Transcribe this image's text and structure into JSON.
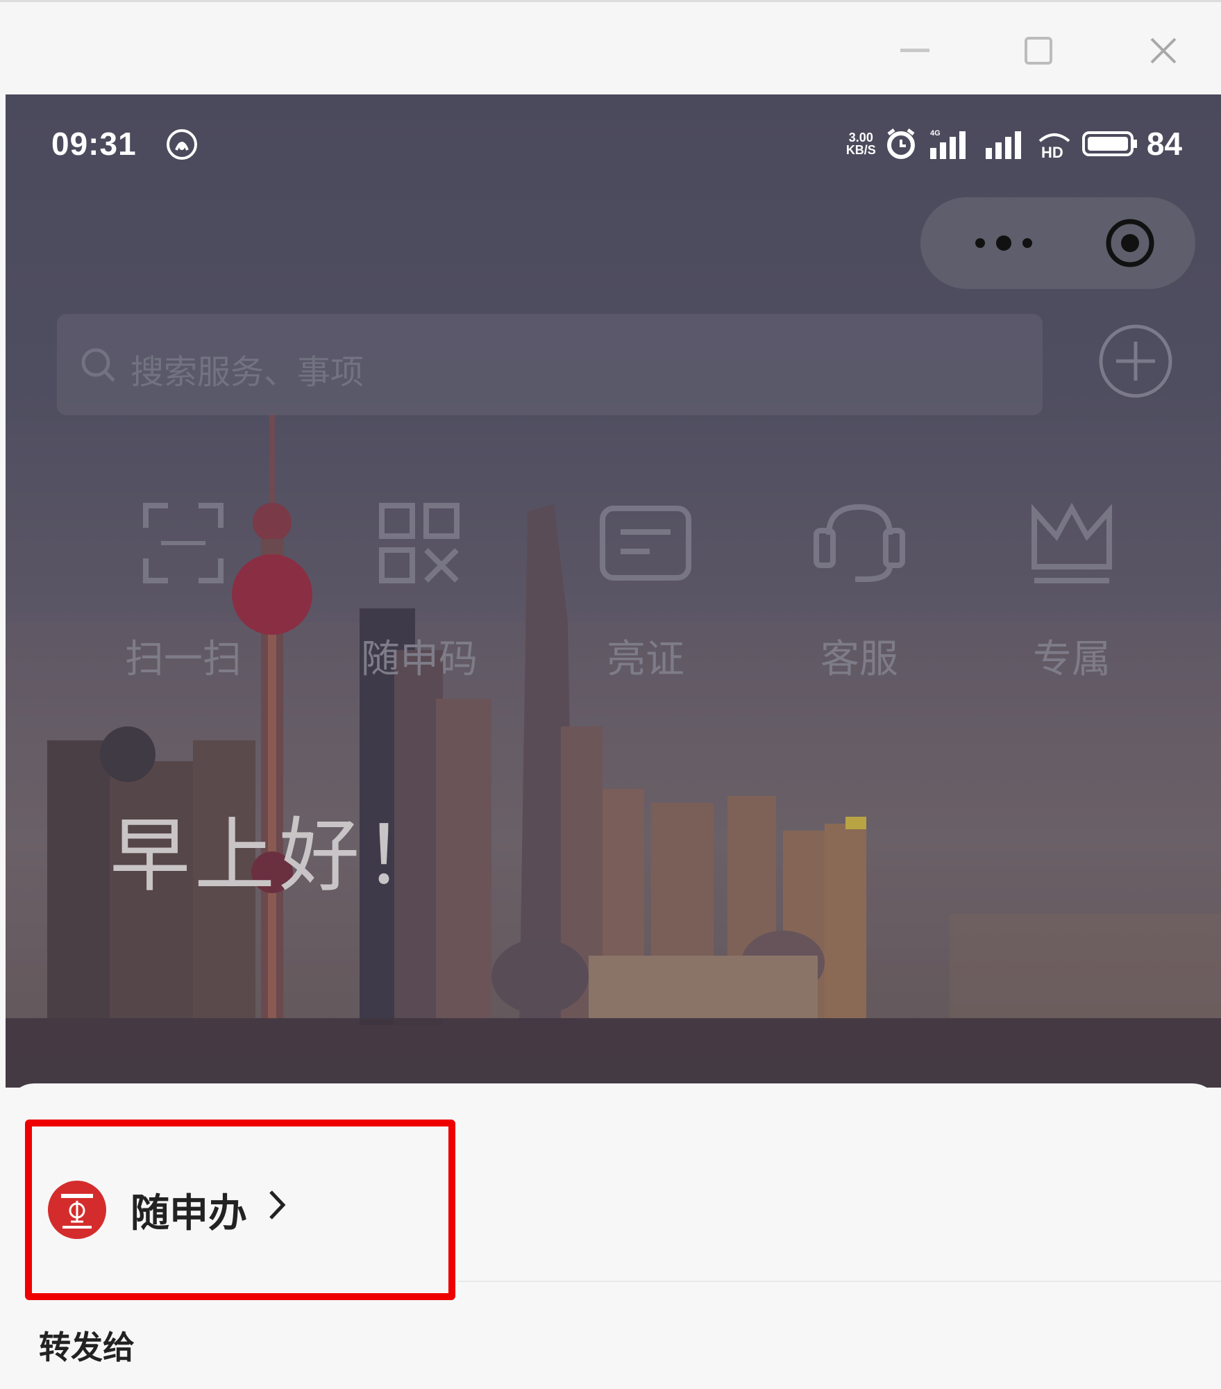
{
  "window": {
    "controls": [
      "minimize-icon",
      "maximize-icon",
      "close-icon"
    ]
  },
  "status_bar": {
    "time": "09:31",
    "net_speed_top": "3.00",
    "net_speed_bottom": "KB/S",
    "battery": "84",
    "icons": [
      "nfc-icon",
      "alarm-icon",
      "signal-4g-icon",
      "signal-icon",
      "hd-icon",
      "battery-icon"
    ]
  },
  "capsule": {
    "more_icon": "ellipsis-icon",
    "close_icon": "target-icon"
  },
  "search": {
    "placeholder": "搜索服务、事项",
    "add_icon": "plus-circle-icon"
  },
  "shortcuts": [
    {
      "label": "扫一扫",
      "icon": "scan-icon"
    },
    {
      "label": "随申码",
      "icon": "qr-code-icon"
    },
    {
      "label": "亮证",
      "icon": "id-card-icon"
    },
    {
      "label": "客服",
      "icon": "headset-icon"
    },
    {
      "label": "专属",
      "icon": "crown-icon"
    }
  ],
  "greeting": "早上好！",
  "sheet": {
    "app_name": "随申办",
    "forward_label": "转发给",
    "highlight_color": "#ee0000",
    "logo_color": "#d42c2c"
  }
}
